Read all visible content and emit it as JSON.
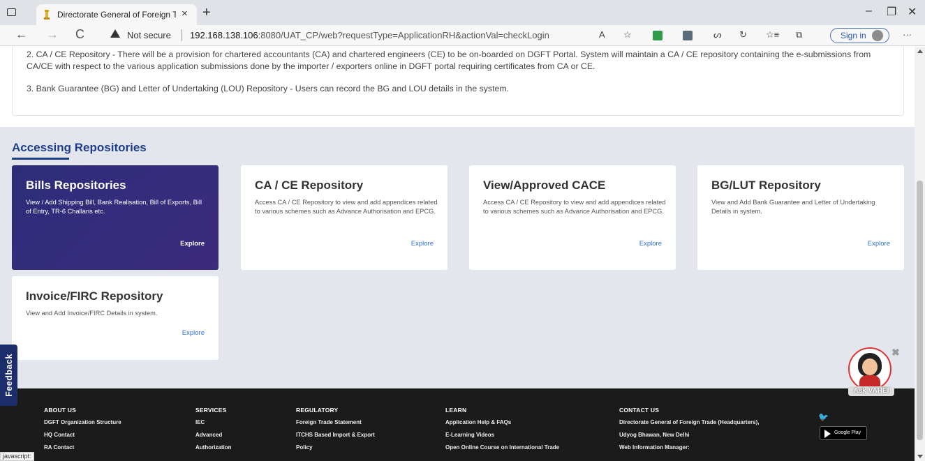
{
  "browser": {
    "tab_title": "Directorate General of Foreign Tr",
    "tab_close": "×",
    "new_tab": "+",
    "minimize": "–",
    "restore": "❐",
    "close": "✕",
    "back": "←",
    "forward": "→",
    "reload": "C",
    "not_secure": "Not secure",
    "url_host": "192.168.138.106",
    "url_rest": ":8080/UAT_CP/web?requestType=ApplicationRH&actionVal=checkLogin",
    "read_aloud": "A",
    "favorite": "☆",
    "collections": "⊕",
    "extensions": "⋯",
    "sign_in": "Sign in",
    "more": "···",
    "toolbar_glyphs": [
      "ᔕ",
      "↻",
      "☆≡",
      "⧉"
    ]
  },
  "info": {
    "item2": "2. CA / CE Repository - There will be a provision for chartered accountants (CA) and chartered engineers (CE) to be on-boarded on DGFT Portal. System will maintain a CA / CE repository containing the e-submissions from CA/CE with respect to the various application submissions done by the importer / exporters online in DGFT portal requiring certificates from CA or CE.",
    "item3": "3. Bank Guarantee (BG) and Letter of Undertaking (LOU) Repository - Users can record the BG and LOU details in the system."
  },
  "repositories": {
    "heading": "Accessing Repositories",
    "cards": [
      {
        "title": "Bills Repositories",
        "desc": "View / Add Shipping Bill, Bank Realisation, Bill of Exports, Bill of Entry, TR-6 Challans etc.",
        "explore": "Explore"
      },
      {
        "title": "CA / CE Repository",
        "desc": "Access CA / CE Repository to view and add appendices related to various schemes such as Advance Authorisation and EPCG.",
        "explore": "Explore"
      },
      {
        "title": "View/Approved CACE",
        "desc": "Access CA / CE Repository to view and add appendices related to various schemes such as Advance Authorisation and EPCG.",
        "explore": "Explore"
      },
      {
        "title": "BG/LUT Repository",
        "desc": "View and Add Bank Guarantee and Letter of Undertaking Details in system.",
        "explore": "Explore"
      },
      {
        "title": "Invoice/FIRC Repository",
        "desc": "View and Add Invoice/FIRC Details in system.",
        "explore": "Explore"
      }
    ]
  },
  "feedback": "Feedback",
  "footer": {
    "about": {
      "head": "ABOUT US",
      "links": [
        "DGFT Organization Structure",
        "HQ Contact",
        "RA Contact"
      ]
    },
    "services": {
      "head": "SERVICES",
      "links": [
        "IEC",
        "Advanced",
        "Authorization"
      ]
    },
    "regulatory": {
      "head": "REGULATORY",
      "links": [
        "Foreign Trade Statement",
        "ITCHS Based Import & Export",
        "Policy"
      ]
    },
    "learn": {
      "head": "LEARN",
      "links": [
        "Application Help & FAQs",
        "E-Learning Videos",
        "Open Online Course on International Trade"
      ]
    },
    "contact": {
      "head": "CONTACT US",
      "links": [
        "Directorate General of Foreign Trade (Headquarters),",
        "Udyog Bhawan, New Delhi",
        "Web Information Manager:"
      ]
    },
    "twitter": "🐦",
    "playstore": "Google Play"
  },
  "chatbot": {
    "label": "Ask VAHEI",
    "close": "✖"
  },
  "status_tip": "javascript:"
}
